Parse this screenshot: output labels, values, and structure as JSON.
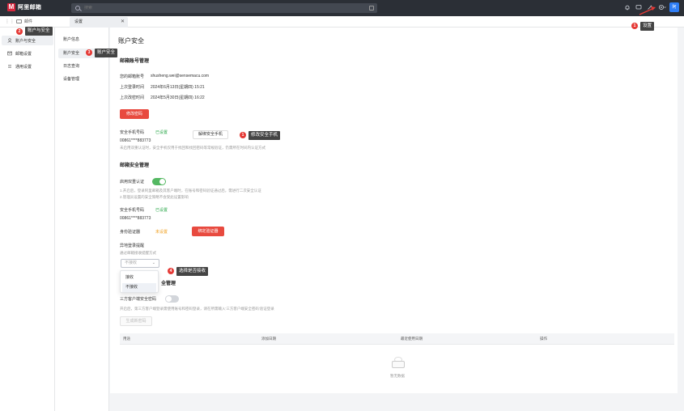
{
  "topbar": {
    "logo_text": "阿里邮箱",
    "logo_mark": "M",
    "search_placeholder": "搜索",
    "avatar_text": "阿"
  },
  "tabs": {
    "mail_label": "邮件",
    "settings_label": "设置",
    "close_glyph": "✕"
  },
  "sidebar": {
    "items": [
      {
        "label": "账户与安全",
        "icon": "user-icon"
      },
      {
        "label": "邮箱设置",
        "icon": "mail-settings-icon"
      },
      {
        "label": "通用设置",
        "icon": "general-settings-icon"
      }
    ]
  },
  "subnav": {
    "items": [
      {
        "label": "账户信息"
      },
      {
        "label": "账户安全"
      },
      {
        "label": "日志查询"
      },
      {
        "label": "设备管理"
      }
    ]
  },
  "content": {
    "page_title": "账户安全",
    "section_account": "邮箱账号管理",
    "email_label": "您的邮箱账号",
    "email_value": "shusheng.wei@sensemacu.com",
    "last_login_label": "上次登录时间",
    "last_login_value": "2024年6月13日(星期四) 15:21",
    "last_pwd_label": "上次改密时间",
    "last_pwd_value": "2024年5月30日(星期四) 16:22",
    "change_pwd_button": "修改密码",
    "security_phone_label": "安全手机号码",
    "security_phone_status": "已设置",
    "security_phone_value": "00861****883773",
    "security_phone_note": "未启用双重认证时，安全手机仅用于找回和找回密码等常规验证，仍需所在时间内认证方式",
    "unbind_phone_button": "解绑安全手机",
    "section_mailbox_security": "邮箱安全管理",
    "two_factor_label": "启用双重认证",
    "two_factor_note1": "1.开启后，登录阿里邮箱及其客户端时，在账号和密码验证通过后，需进行二次安全认证",
    "two_factor_note2": "2.管理员设置的安全策略不会受此设置影响",
    "phone2_label": "安全手机号码",
    "phone2_status": "已设置",
    "phone2_value": "00861****883773",
    "authenticator_label": "身份验证器",
    "authenticator_status": "未设置",
    "bind_authenticator_button": "绑定验证器",
    "remote_login_label": "异地登录提醒",
    "remote_login_sub": "通过邮箱接收提醒方式",
    "select_value": "不接收",
    "dropdown_options": [
      "接收",
      "不接收"
    ],
    "section_third_party_partial": "全管理",
    "third_party_label": "三方客户端安全密码",
    "third_party_note": "开启后，第三方客户端登录需使用账号和密码登录，请在所需输入'三方客户端安全密码'验证登录",
    "generate_pwd_button": "生成新密码",
    "table_headers": [
      "用途",
      "添加日期",
      "最近使用日期",
      "操作"
    ],
    "empty_text": "暂无数据"
  },
  "annotations": [
    {
      "num": "1",
      "text": "修改安全手机"
    },
    {
      "num": "2",
      "text": "账户与安全"
    },
    {
      "num": "3",
      "text": "账户安全"
    },
    {
      "num": "4",
      "text": "选择是否接收"
    },
    {
      "num": "1",
      "text": "设置"
    }
  ],
  "colors": {
    "topbar_bg": "#2b2f36",
    "accent_red": "#e84a3f",
    "status_green": "#2ba84a",
    "status_orange": "#f0a020",
    "toggle_on": "#54b862",
    "avatar_blue": "#2f7ef6"
  }
}
